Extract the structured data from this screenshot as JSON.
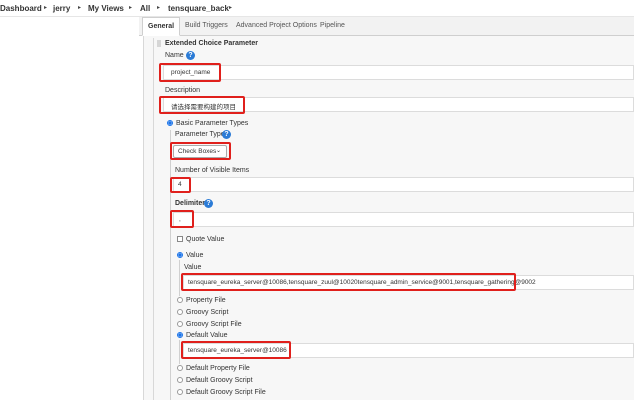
{
  "breadcrumb": {
    "items": [
      "Dashboard",
      "jerry",
      "My Views",
      "All",
      "tensquare_back"
    ]
  },
  "tabs": [
    "General",
    "Build Triggers",
    "Advanced Project Options",
    "Pipeline"
  ],
  "parameter": {
    "title": "Extended Choice Parameter",
    "name_label": "Name",
    "name_value": "project_name",
    "description_label": "Description",
    "description_value": "请选择需要构建的项目",
    "basic_types_label": "Basic Parameter Types",
    "type_label": "Parameter Type",
    "type_value": "Check Boxes",
    "visible_items_label": "Number of Visible Items",
    "visible_items_value": "4",
    "delimiter_label": "Delimiter",
    "delimiter_value": ",",
    "quote_value_label": "Quote Value",
    "value_radio_label": "Value",
    "value_field_label": "Value",
    "value_field_value": "tensquare_eureka_server@10086,tensquare_zuul@10020tensquare_admin_service@9001,tensquare_gathering@9002",
    "property_file_label": "Property File",
    "groovy_script_label": "Groovy Script",
    "groovy_script_file_label": "Groovy Script File",
    "default_value_label": "Default Value",
    "default_value_value": "tensquare_eureka_server@10086",
    "default_property_file_label": "Default Property File",
    "default_groovy_script_label": "Default Groovy Script",
    "default_groovy_script_file_label": "Default Groovy Script File"
  },
  "icons": {
    "help": "help-icon",
    "separator": "breadcrumb-separator-icon",
    "dropdown": "chevron-down-icon"
  },
  "help_glyph": "?",
  "colors": {
    "highlight": "#e0201c",
    "help": "#2b7bd6",
    "radio": "#1a73e8"
  }
}
